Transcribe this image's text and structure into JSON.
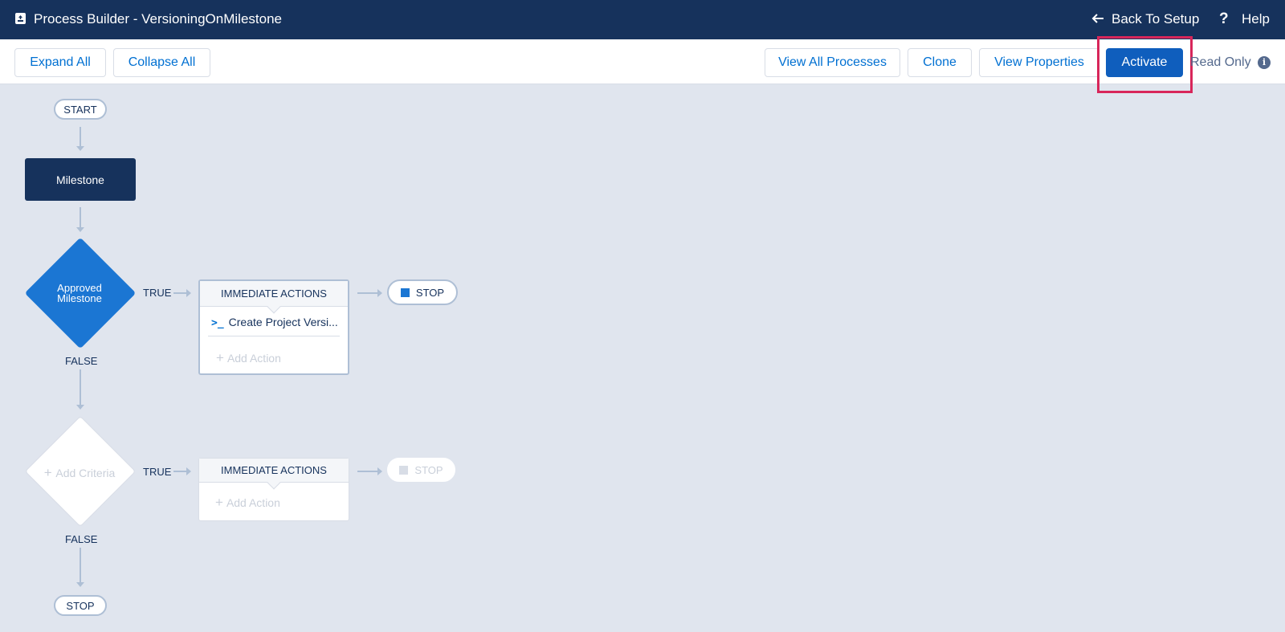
{
  "header": {
    "title": "Process Builder - VersioningOnMilestone",
    "back_label": "Back To Setup",
    "help_label": "Help",
    "help_glyph": "?"
  },
  "toolbar": {
    "expand_all": "Expand All",
    "collapse_all": "Collapse All",
    "view_all_processes": "View All Processes",
    "clone": "Clone",
    "view_properties": "View Properties",
    "activate": "Activate",
    "read_only": "Read Only",
    "info_glyph": "i"
  },
  "canvas": {
    "start_label": "START",
    "object_node": "Milestone",
    "criteria1": {
      "name_line1": "Approved",
      "name_line2": "Milestone",
      "true_label": "TRUE",
      "false_label": "FALSE",
      "actions_header": "IMMEDIATE ACTIONS",
      "action_item": "Create Project Versi...",
      "action_glyph": ">_",
      "add_action": "Add Action",
      "stop_label": "STOP"
    },
    "criteria2": {
      "placeholder": "Add Criteria",
      "true_label": "TRUE",
      "false_label": "FALSE",
      "actions_header": "IMMEDIATE ACTIONS",
      "add_action": "Add Action",
      "stop_label": "STOP"
    },
    "end_label": "STOP"
  },
  "colors": {
    "header_bg": "#16325c",
    "brand_blue": "#0070d2",
    "primary_button": "#0f5ebd",
    "criteria_fill": "#1b76d3",
    "highlight": "#d8265a",
    "connector": "#aebfd5"
  },
  "icons": [
    "process-builder-icon",
    "back-arrow-icon",
    "help-icon",
    "info-icon",
    "apex-icon",
    "plus-icon",
    "stop-icon"
  ]
}
